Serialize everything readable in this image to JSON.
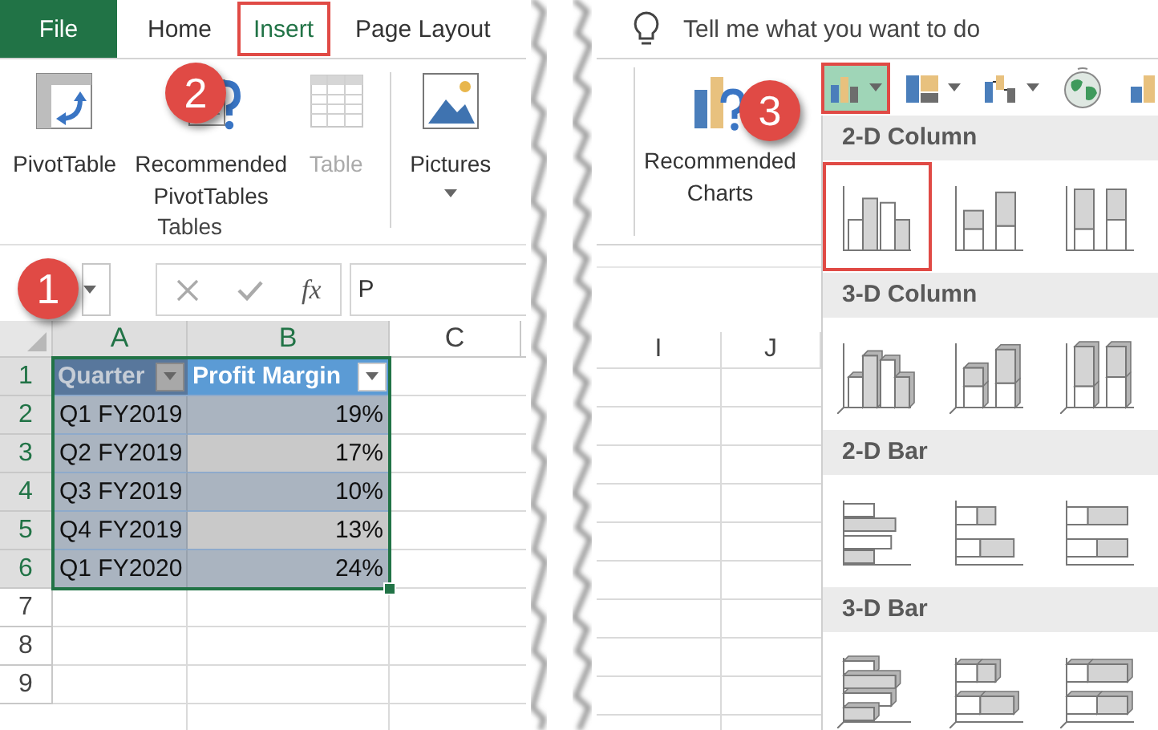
{
  "tabs": [
    {
      "label": "File",
      "kind": "file",
      "selected": false
    },
    {
      "label": "Home",
      "kind": "tab",
      "selected": false
    },
    {
      "label": "Insert",
      "kind": "tab",
      "selected": true
    },
    {
      "label": "Page Layout",
      "kind": "tab",
      "selected": false
    }
  ],
  "tables_group": {
    "label": "Tables",
    "commands": [
      {
        "kind": "pivot-table",
        "label": "PivotTable",
        "disabled": false
      },
      {
        "kind": "recommended-pivot",
        "label": "Recommended PivotTables",
        "disabled": false
      },
      {
        "kind": "table",
        "label": "Table",
        "disabled": true
      }
    ]
  },
  "pictures": {
    "label": "Pictures",
    "has_menu": true
  },
  "formula_bar": {
    "function_label": "fx",
    "value": "P"
  },
  "steps": [
    "1",
    "2",
    "3"
  ],
  "sheet": {
    "columns": [
      {
        "label": "A",
        "selected": true
      },
      {
        "label": "B",
        "selected": true
      },
      {
        "label": "C",
        "selected": false
      }
    ],
    "rows": [
      {
        "label": "1",
        "selected": true
      },
      {
        "label": "2",
        "selected": true
      },
      {
        "label": "3",
        "selected": true
      },
      {
        "label": "4",
        "selected": true
      },
      {
        "label": "5",
        "selected": true
      },
      {
        "label": "6",
        "selected": true
      },
      {
        "label": "7",
        "selected": false
      },
      {
        "label": "8",
        "selected": false
      },
      {
        "label": "9",
        "selected": false
      }
    ],
    "table": {
      "headers": [
        "Quarter",
        "Profit Margin"
      ],
      "rows": [
        [
          "Q1 FY2019",
          "19%"
        ],
        [
          "Q2 FY2019",
          "17%"
        ],
        [
          "Q3 FY2019",
          "10%"
        ],
        [
          "Q4 FY2019",
          "13%"
        ],
        [
          "Q1 FY2020",
          "24%"
        ]
      ]
    }
  },
  "tell_me": {
    "placeholder": "Tell me what you want to do"
  },
  "recommended_charts": {
    "label": "Recommended Charts"
  },
  "right_columns": [
    "I",
    "J"
  ],
  "chart_buttons": [
    {
      "kind": "column",
      "selected": true,
      "has_menu": true
    },
    {
      "kind": "hierarchy",
      "selected": false,
      "has_menu": true
    },
    {
      "kind": "waterfall",
      "selected": false,
      "has_menu": true
    },
    {
      "kind": "map",
      "selected": false,
      "has_menu": false
    },
    {
      "kind": "combo",
      "selected": false,
      "has_menu": false
    }
  ],
  "gallery": [
    {
      "title": "2-D Column",
      "items": [
        {
          "kind": "clustered-column",
          "selected": true
        },
        {
          "kind": "stacked-column",
          "selected": false
        },
        {
          "kind": "full-stacked-column",
          "selected": false
        }
      ]
    },
    {
      "title": "3-D Column",
      "items": [
        {
          "kind": "clustered-column-3d",
          "selected": false
        },
        {
          "kind": "stacked-column-3d",
          "selected": false
        },
        {
          "kind": "full-stacked-column-3d",
          "selected": false
        }
      ]
    },
    {
      "title": "2-D Bar",
      "items": [
        {
          "kind": "clustered-bar",
          "selected": false
        },
        {
          "kind": "stacked-bar",
          "selected": false
        },
        {
          "kind": "full-stacked-bar",
          "selected": false
        }
      ]
    },
    {
      "title": "3-D Bar",
      "items": [
        {
          "kind": "clustered-bar-3d",
          "selected": false
        },
        {
          "kind": "stacked-bar-3d",
          "selected": false
        },
        {
          "kind": "full-stacked-bar-3d",
          "selected": false
        }
      ]
    }
  ]
}
